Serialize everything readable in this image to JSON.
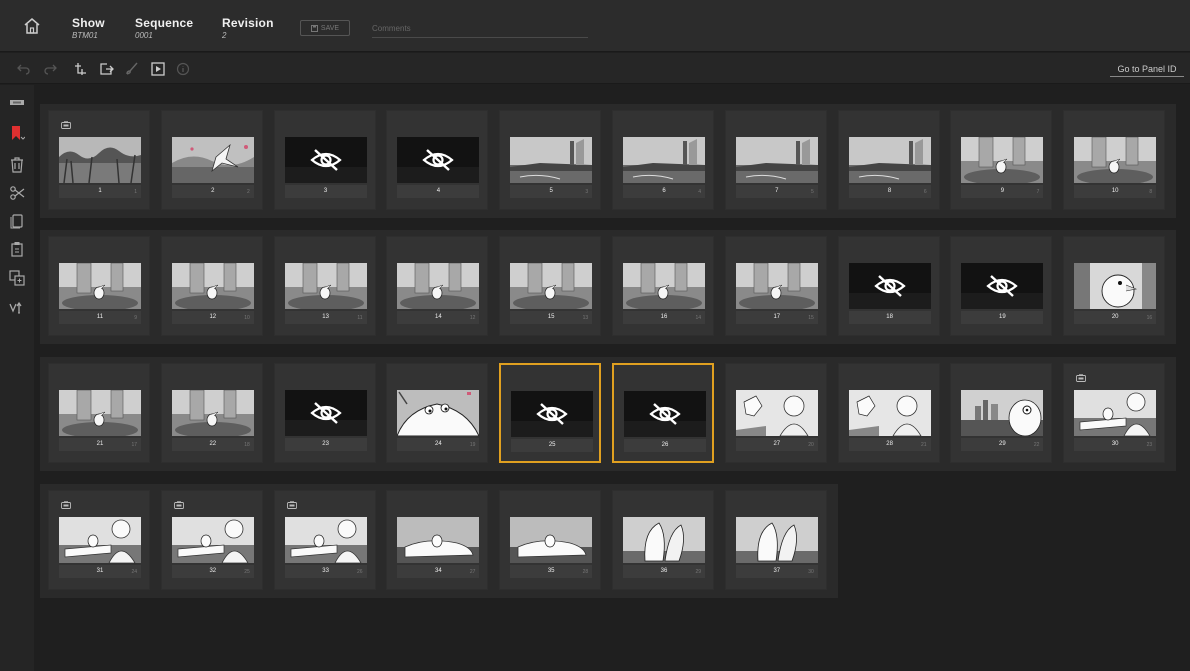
{
  "header": {
    "show": {
      "label": "Show",
      "value": "BTM01"
    },
    "sequence": {
      "label": "Sequence",
      "value": "0001"
    },
    "revision": {
      "label": "Revision",
      "value": "2"
    },
    "save_label": "SAVE",
    "comments_placeholder": "Comments"
  },
  "toolbar": {
    "goto_label": "Go to Panel ID",
    "icons": [
      "undo-icon",
      "redo-icon",
      "import-panel-icon",
      "export-icon",
      "brush-icon",
      "play-icon",
      "info-icon"
    ]
  },
  "sidebar": {
    "icons": [
      "new-panel-icon",
      "bookmark-icon",
      "trash-icon",
      "scissors-icon",
      "copy-icon",
      "paste-icon",
      "duplicate-icon",
      "version-icon"
    ],
    "accent": "#e03030"
  },
  "colors": {
    "selection": "#e0a020",
    "background": "#1f1f1f"
  },
  "rows": [
    {
      "panels": [
        {
          "number": "1",
          "sub": "1",
          "scene": "beach",
          "camera": true
        },
        {
          "number": "2",
          "sub": "2",
          "scene": "beach-bird"
        },
        {
          "number": "3",
          "sub": "",
          "scene": "hidden"
        },
        {
          "number": "4",
          "sub": "",
          "scene": "hidden"
        },
        {
          "number": "5",
          "sub": "3",
          "scene": "coast"
        },
        {
          "number": "6",
          "sub": "4",
          "scene": "coast"
        },
        {
          "number": "7",
          "sub": "5",
          "scene": "coast"
        },
        {
          "number": "8",
          "sub": "6",
          "scene": "coast"
        },
        {
          "number": "9",
          "sub": "7",
          "scene": "bird-shoe"
        },
        {
          "number": "10",
          "sub": "8",
          "scene": "bird-shoe"
        }
      ]
    },
    {
      "panels": [
        {
          "number": "11",
          "sub": "9",
          "scene": "bird-shoe"
        },
        {
          "number": "12",
          "sub": "10",
          "scene": "bird-shoe"
        },
        {
          "number": "13",
          "sub": "11",
          "scene": "bird-shoe"
        },
        {
          "number": "14",
          "sub": "12",
          "scene": "bird-shoe"
        },
        {
          "number": "15",
          "sub": "13",
          "scene": "bird-shoe"
        },
        {
          "number": "16",
          "sub": "14",
          "scene": "bird-shoe"
        },
        {
          "number": "17",
          "sub": "15",
          "scene": "bird-shoe"
        },
        {
          "number": "18",
          "sub": "",
          "scene": "hidden"
        },
        {
          "number": "19",
          "sub": "",
          "scene": "hidden"
        },
        {
          "number": "20",
          "sub": "16",
          "scene": "bird-close"
        }
      ]
    },
    {
      "panels": [
        {
          "number": "21",
          "sub": "17",
          "scene": "bird-shoe"
        },
        {
          "number": "22",
          "sub": "18",
          "scene": "bird-shoe"
        },
        {
          "number": "23",
          "sub": "",
          "scene": "hidden"
        },
        {
          "number": "24",
          "sub": "19",
          "scene": "creature"
        },
        {
          "number": "25",
          "sub": "",
          "scene": "hidden",
          "selected": true
        },
        {
          "number": "26",
          "sub": "",
          "scene": "hidden",
          "selected": true
        },
        {
          "number": "27",
          "sub": "20",
          "scene": "man-bird"
        },
        {
          "number": "28",
          "sub": "21",
          "scene": "man-bird"
        },
        {
          "number": "29",
          "sub": "22",
          "scene": "city"
        },
        {
          "number": "30",
          "sub": "23",
          "scene": "man-hand",
          "camera": true
        }
      ]
    },
    {
      "panels": [
        {
          "number": "31",
          "sub": "24",
          "scene": "man-hand",
          "camera": true
        },
        {
          "number": "32",
          "sub": "25",
          "scene": "man-hand",
          "camera": true
        },
        {
          "number": "33",
          "sub": "26",
          "scene": "man-hand",
          "camera": true
        },
        {
          "number": "34",
          "sub": "27",
          "scene": "hand"
        },
        {
          "number": "35",
          "sub": "28",
          "scene": "hand"
        },
        {
          "number": "36",
          "sub": "29",
          "scene": "wings"
        },
        {
          "number": "37",
          "sub": "30",
          "scene": "wings"
        }
      ]
    }
  ]
}
